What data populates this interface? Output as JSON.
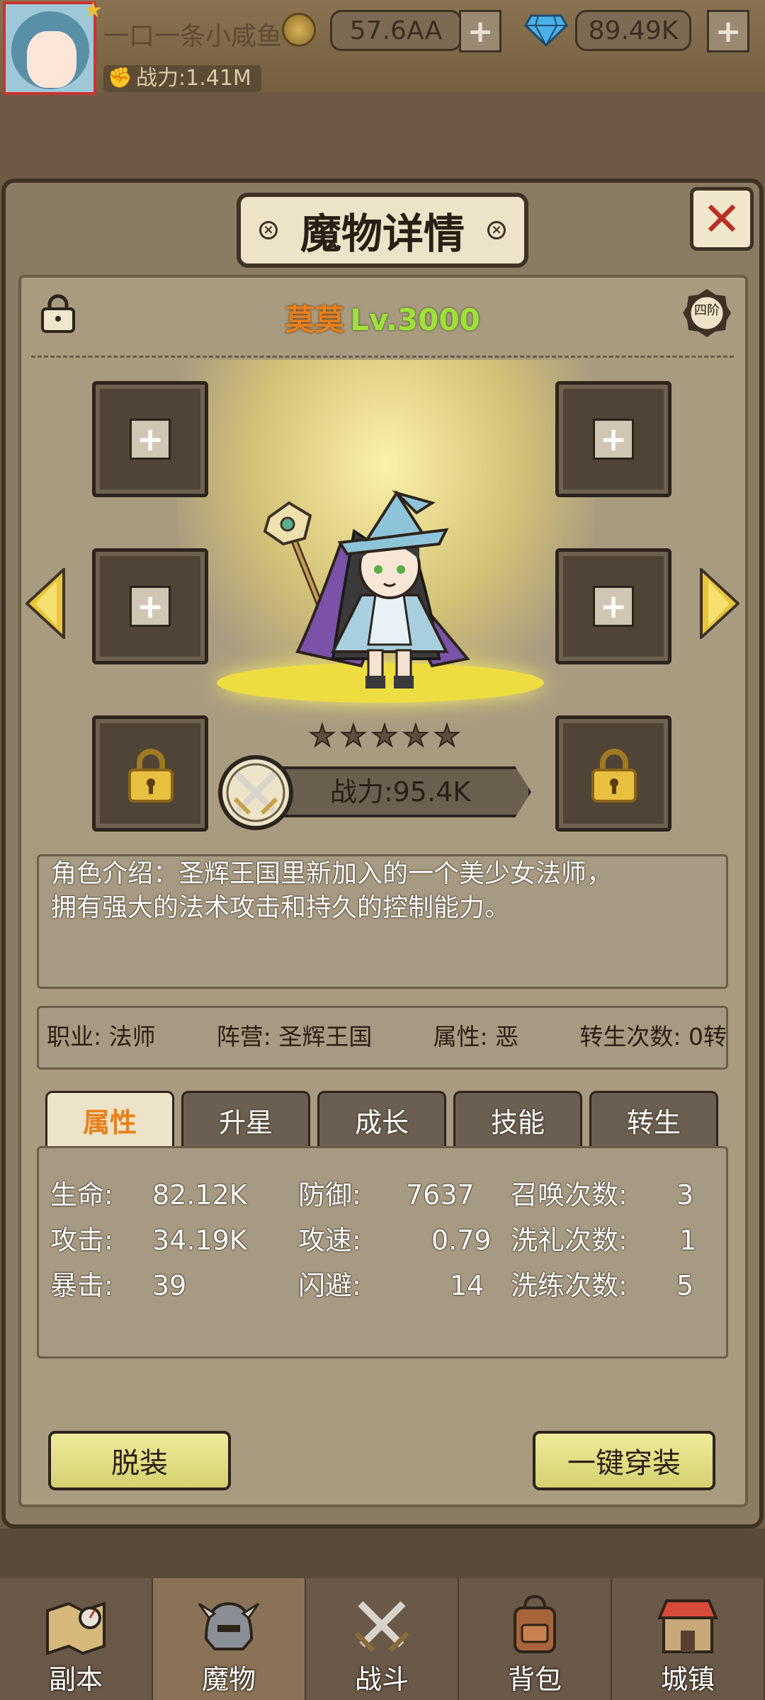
{
  "header": {
    "player_name": "一口一条小咸鱼",
    "gold": "57.6AA",
    "gems": "89.49K",
    "plus": "+",
    "power_label": "战力:1.41M"
  },
  "panel": {
    "title": "魔物详情",
    "close": "✕",
    "tier_badge": "四阶"
  },
  "hero": {
    "name": "莫莫",
    "level": "Lv.3000",
    "stars": 5,
    "power": "战力:95.4K"
  },
  "slots": {
    "plus": "+"
  },
  "description": {
    "line1": "角色介绍：圣辉王国里新加入的一个美少女法师，",
    "line2": "拥有强大的法术攻击和持久的控制能力。"
  },
  "info": {
    "job": "职业: 法师",
    "camp": "阵营: 圣辉王国",
    "attribute": "属性: 恶",
    "rebirth": "转生次数: 0转"
  },
  "tabs": [
    "属性",
    "升星",
    "成长",
    "技能",
    "转生"
  ],
  "stats": {
    "hp_label": "生命:",
    "hp": "82.12K",
    "atk_label": "攻击:",
    "atk": "34.19K",
    "crit_label": "暴击:",
    "crit": "39",
    "def_label": "防御:",
    "def": "7637",
    "spd_label": "攻速:",
    "spd": "0.79",
    "dodge_label": "闪避:",
    "dodge": "14",
    "summon_label": "召唤次数:",
    "summon": "3",
    "baptism_label": "洗礼次数:",
    "baptism": "1",
    "refine_label": "洗练次数:",
    "refine": "5"
  },
  "buttons": {
    "unequip": "脱装",
    "equip_all": "一键穿装"
  },
  "nav": [
    "副本",
    "魔物",
    "战斗",
    "背包",
    "城镇"
  ],
  "colors": {
    "accent_orange": "#e8801c",
    "level_green": "#9fe03a",
    "close_red": "#b83024",
    "button_yellow": "#e6e48a"
  }
}
